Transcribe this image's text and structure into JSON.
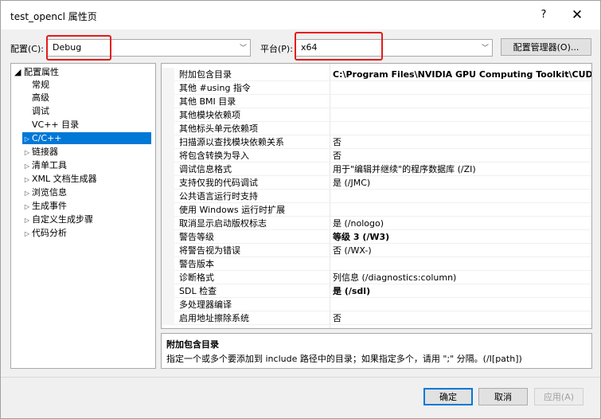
{
  "window": {
    "title": "test_opencl 属性页",
    "help": "?",
    "close": "✕"
  },
  "toolbar": {
    "config_label": "配置(C):",
    "config_value": "Debug",
    "platform_label": "平台(P):",
    "platform_value": "x64",
    "config_manager": "配置管理器(O)...",
    "highlight_color": "#e31b1b"
  },
  "tree": {
    "items": [
      {
        "label": "◢ 配置属性"
      },
      {
        "label": "常规"
      },
      {
        "label": "高级"
      },
      {
        "label": "调试"
      },
      {
        "label": "VC++ 目录"
      },
      {
        "label": "C/C++"
      },
      {
        "label": "链接器"
      },
      {
        "label": "清单工具"
      },
      {
        "label": "XML 文档生成器"
      },
      {
        "label": "浏览信息"
      },
      {
        "label": "生成事件"
      },
      {
        "label": "自定义生成步骤"
      },
      {
        "label": "代码分析"
      }
    ],
    "expander_collapsed": "▷",
    "selected_index": 5
  },
  "properties": [
    {
      "name": "附加包含目录",
      "value": "C:\\Program Files\\NVIDIA GPU Computing Toolkit\\CUDA"
    },
    {
      "name": "其他 #using 指令",
      "value": ""
    },
    {
      "name": "其他 BMI 目录",
      "value": ""
    },
    {
      "name": "其他模块依赖项",
      "value": ""
    },
    {
      "name": "其他标头单元依赖项",
      "value": ""
    },
    {
      "name": "扫描源以查找模块依赖关系",
      "value": "否"
    },
    {
      "name": "将包含转换为导入",
      "value": "否"
    },
    {
      "name": "调试信息格式",
      "value": "用于\"编辑并继续\"的程序数据库 (/ZI)"
    },
    {
      "name": "支持仅我的代码调试",
      "value": "是 (/JMC)"
    },
    {
      "name": "公共语言运行时支持",
      "value": ""
    },
    {
      "name": "使用 Windows 运行时扩展",
      "value": ""
    },
    {
      "name": "取消显示启动版权标志",
      "value": "是 (/nologo)"
    },
    {
      "name": "警告等级",
      "value": "等级 3 (/W3)"
    },
    {
      "name": "将警告视为错误",
      "value": "否 (/WX-)"
    },
    {
      "name": "警告版本",
      "value": ""
    },
    {
      "name": "诊断格式",
      "value": "列信息 (/diagnostics:column)"
    },
    {
      "name": "SDL 检查",
      "value": "是 (/sdl)"
    },
    {
      "name": "多处理器编译",
      "value": ""
    },
    {
      "name": "启用地址擦除系统",
      "value": "否"
    }
  ],
  "description": {
    "title": "附加包含目录",
    "text": "指定一个或多个要添加到 include 路径中的目录；如果指定多个，请用 \";\" 分隔。(/I[path])"
  },
  "buttons": {
    "ok": "确定",
    "cancel": "取消",
    "apply": "应用(A)"
  }
}
